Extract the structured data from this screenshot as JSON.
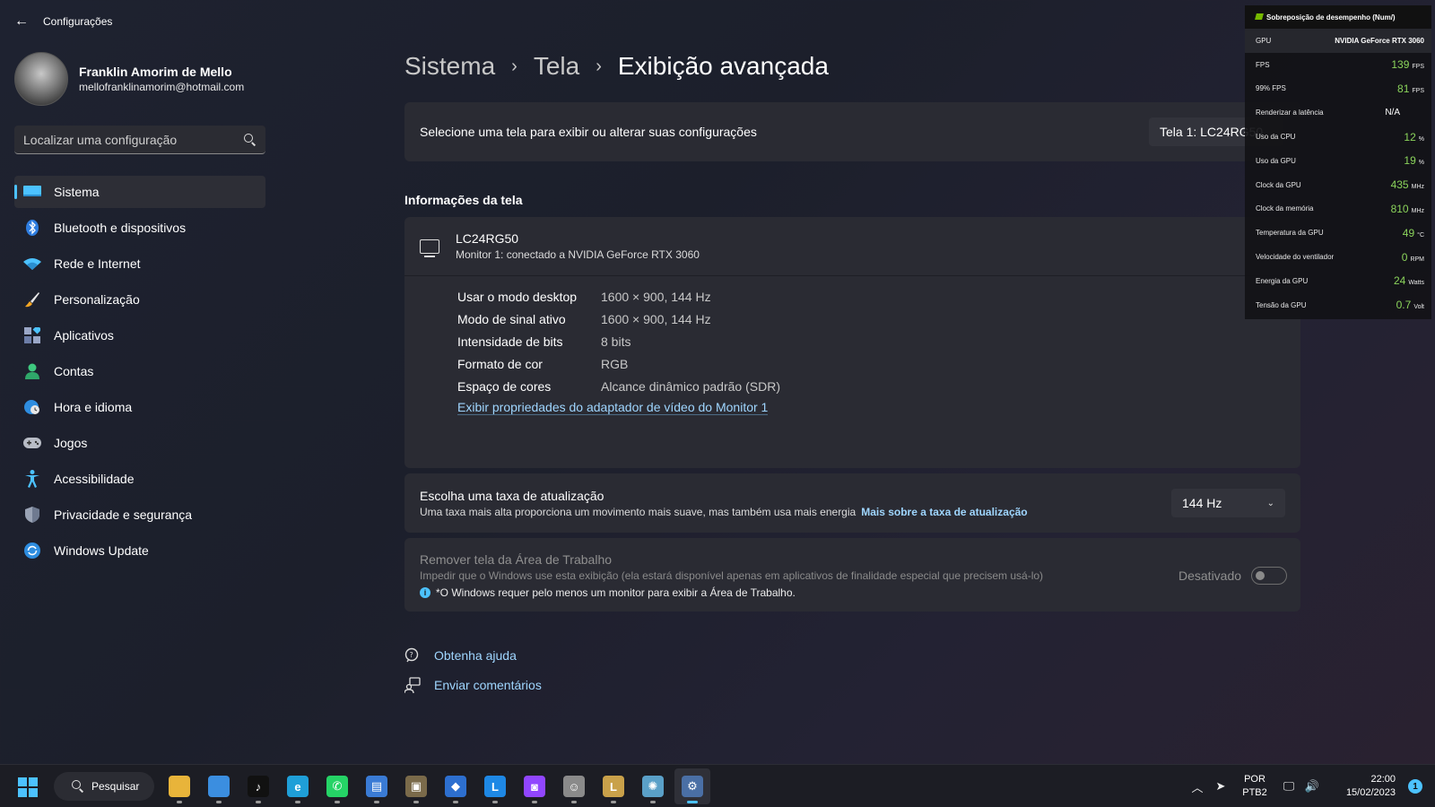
{
  "window": {
    "title": "Configurações",
    "back_icon": "arrow-left-icon"
  },
  "profile": {
    "name": "Franklin Amorim de Mello",
    "email": "mellofranklinamorim@hotmail.com"
  },
  "search": {
    "placeholder": "Localizar uma configuração"
  },
  "sidebar": {
    "items": [
      {
        "label": "Sistema",
        "icon": "monitor-icon",
        "active": true
      },
      {
        "label": "Bluetooth e dispositivos",
        "icon": "bluetooth-icon"
      },
      {
        "label": "Rede e Internet",
        "icon": "wifi-icon"
      },
      {
        "label": "Personalização",
        "icon": "brush-icon"
      },
      {
        "label": "Aplicativos",
        "icon": "apps-icon"
      },
      {
        "label": "Contas",
        "icon": "person-icon"
      },
      {
        "label": "Hora e idioma",
        "icon": "globe-clock-icon"
      },
      {
        "label": "Jogos",
        "icon": "gamepad-icon"
      },
      {
        "label": "Acessibilidade",
        "icon": "accessibility-icon"
      },
      {
        "label": "Privacidade e segurança",
        "icon": "shield-icon"
      },
      {
        "label": "Windows Update",
        "icon": "update-icon"
      }
    ]
  },
  "breadcrumb": [
    "Sistema",
    "Tela",
    "Exibição avançada"
  ],
  "display_select": {
    "text": "Selecione uma tela para exibir ou alterar suas configurações",
    "value": "Tela 1: LC24RG50"
  },
  "display_info": {
    "section_title": "Informações da tela",
    "monitor_name": "LC24RG50",
    "monitor_sub": "Monitor 1: conectado a NVIDIA GeForce RTX 3060",
    "rows": [
      {
        "key": "Usar o modo desktop",
        "value": "1600 × 900, 144 Hz"
      },
      {
        "key": "Modo de sinal ativo",
        "value": "1600 × 900, 144 Hz"
      },
      {
        "key": "Intensidade de bits",
        "value": "8 bits"
      },
      {
        "key": "Formato de cor",
        "value": "RGB"
      },
      {
        "key": "Espaço de cores",
        "value": "Alcance dinâmico padrão (SDR)"
      }
    ],
    "adapter_link": "Exibir propriedades do adaptador de vídeo do Monitor 1"
  },
  "refresh": {
    "title": "Escolha uma taxa de atualização",
    "subtitle": "Uma taxa mais alta proporciona um movimento mais suave, mas também usa mais energia",
    "link": "Mais sobre a taxa de atualização",
    "value": "144 Hz"
  },
  "remove": {
    "title": "Remover tela da Área de Trabalho",
    "subtitle": "Impedir que o Windows use esta exibição (ela estará disponível apenas em aplicativos de finalidade especial que precisem usá-lo)",
    "note": "*O Windows requer pelo menos um monitor para exibir a Área de Trabalho.",
    "toggle_label": "Desativado",
    "toggle_on": false
  },
  "help": {
    "get_help": "Obtenha ajuda",
    "feedback": "Enviar comentários"
  },
  "overlay": {
    "title": "Sobreposição de desempenho (Num/)",
    "gpu_label": "GPU",
    "gpu_name": "NVIDIA GeForce RTX 3060",
    "stats": [
      {
        "label": "FPS",
        "value": "139",
        "unit": "FPS"
      },
      {
        "label": "99% FPS",
        "value": "81",
        "unit": "FPS"
      },
      {
        "label": "Renderizar a latência",
        "value": "N/A",
        "unit": ""
      },
      {
        "label": "Uso da CPU",
        "value": "12",
        "unit": "%"
      },
      {
        "label": "Uso da GPU",
        "value": "19",
        "unit": "%"
      },
      {
        "label": "Clock da GPU",
        "value": "435",
        "unit": "MHz"
      },
      {
        "label": "Clock da memória",
        "value": "810",
        "unit": "MHz"
      },
      {
        "label": "Temperatura da GPU",
        "value": "49",
        "unit": "°C"
      },
      {
        "label": "Velocidade do ventilador",
        "value": "0",
        "unit": "RPM"
      },
      {
        "label": "Energia da GPU",
        "value": "24",
        "unit": "Watts"
      },
      {
        "label": "Tensão da GPU",
        "value": "0.7",
        "unit": "Volt"
      }
    ]
  },
  "taskbar": {
    "search_label": "Pesquisar",
    "apps": [
      {
        "name": "file-explorer-icon",
        "glyph": "",
        "color": "#e8b43a"
      },
      {
        "name": "microsoft-store-icon",
        "glyph": "",
        "color": "#3b8ee0"
      },
      {
        "name": "tiktok-icon",
        "glyph": "♪",
        "color": "#111111"
      },
      {
        "name": "edge-icon",
        "glyph": "e",
        "color": "#1f9fd8"
      },
      {
        "name": "whatsapp-icon",
        "glyph": "✆",
        "color": "#25d366"
      },
      {
        "name": "app-window-icon",
        "glyph": "▤",
        "color": "#3a7bd5"
      },
      {
        "name": "app-archive-icon",
        "glyph": "▣",
        "color": "#7a6a4a"
      },
      {
        "name": "app-cube-icon",
        "glyph": "◆",
        "color": "#2d6fcf"
      },
      {
        "name": "app-l-icon",
        "glyph": "L",
        "color": "#1e88e5"
      },
      {
        "name": "twitch-icon",
        "glyph": "◙",
        "color": "#9146ff"
      },
      {
        "name": "app-character-icon",
        "glyph": "☺",
        "color": "#8a8a8a"
      },
      {
        "name": "league-icon",
        "glyph": "L",
        "color": "#c9a14a"
      },
      {
        "name": "app-brain-icon",
        "glyph": "✺",
        "color": "#5aa0c8"
      },
      {
        "name": "settings-icon",
        "glyph": "⚙",
        "color": "#4a6fa5",
        "active": true
      }
    ],
    "lang_line1": "POR",
    "lang_line2": "PTB2",
    "time": "22:00",
    "date": "15/02/2023",
    "notification_count": "1"
  },
  "colors": {
    "accent": "#4cc2ff",
    "link": "#9fd6ff",
    "overlay_value": "#8bd45b",
    "nvidia": "#76b900"
  }
}
